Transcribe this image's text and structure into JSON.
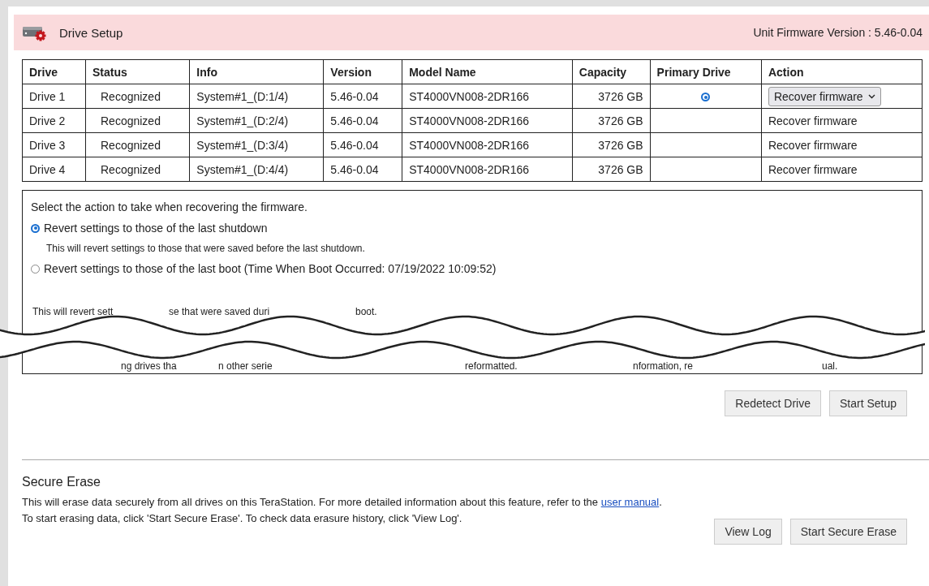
{
  "header": {
    "title": "Drive Setup",
    "firmware": "Unit Firmware Version : 5.46-0.04"
  },
  "table": {
    "columns": [
      "Drive",
      "Status",
      "Info",
      "Version",
      "Model Name",
      "Capacity",
      "Primary Drive",
      "Action"
    ],
    "rows": [
      {
        "drive": "Drive 1",
        "status": "Recognized",
        "info": "System#1_(D:1/4)",
        "version": "5.46-0.04",
        "model": "ST4000VN008-2DR166",
        "capacity": "3726 GB",
        "primary": true,
        "action": "Recover firmware",
        "dropdown": true
      },
      {
        "drive": "Drive 2",
        "status": "Recognized",
        "info": "System#1_(D:2/4)",
        "version": "5.46-0.04",
        "model": "ST4000VN008-2DR166",
        "capacity": "3726 GB",
        "primary": false,
        "action": "Recover firmware",
        "dropdown": false
      },
      {
        "drive": "Drive 3",
        "status": "Recognized",
        "info": "System#1_(D:3/4)",
        "version": "5.46-0.04",
        "model": "ST4000VN008-2DR166",
        "capacity": "3726 GB",
        "primary": false,
        "action": "Recover firmware",
        "dropdown": false
      },
      {
        "drive": "Drive 4",
        "status": "Recognized",
        "info": "System#1_(D:4/4)",
        "version": "5.46-0.04",
        "model": "ST4000VN008-2DR166",
        "capacity": "3726 GB",
        "primary": false,
        "action": "Recover firmware",
        "dropdown": false
      }
    ]
  },
  "recovery": {
    "prompt": "Select the action to take when recovering the firmware.",
    "options": [
      {
        "label": "Revert settings to those of the last shutdown",
        "description": "This will revert settings to those that were saved before the last shutdown.",
        "selected": true
      },
      {
        "label": "Revert settings to those of the last boot (Time When Boot Occurred: 07/19/2022 10:09:52)",
        "selected": false
      }
    ],
    "cut_text_above": [
      "This will revert sett",
      "se that were saved duri",
      "boot."
    ],
    "cut_text_below": [
      "ng drives tha",
      "n other serie",
      "reformatted.",
      "nformation, re",
      "ual."
    ]
  },
  "setup_buttons": [
    "Redetect Drive",
    "Start Setup"
  ],
  "secure_erase": {
    "title": "Secure Erase",
    "text": "This will erase data securely from all drives on this TeraStation. For more detailed information about this feature, refer to the",
    "link": "user manual",
    "text_end": ".",
    "text2": "To start erasing data, click 'Start Secure Erase'. To check data erasure history, click 'View Log'.",
    "buttons": [
      "View Log",
      "Start Secure Erase"
    ]
  }
}
